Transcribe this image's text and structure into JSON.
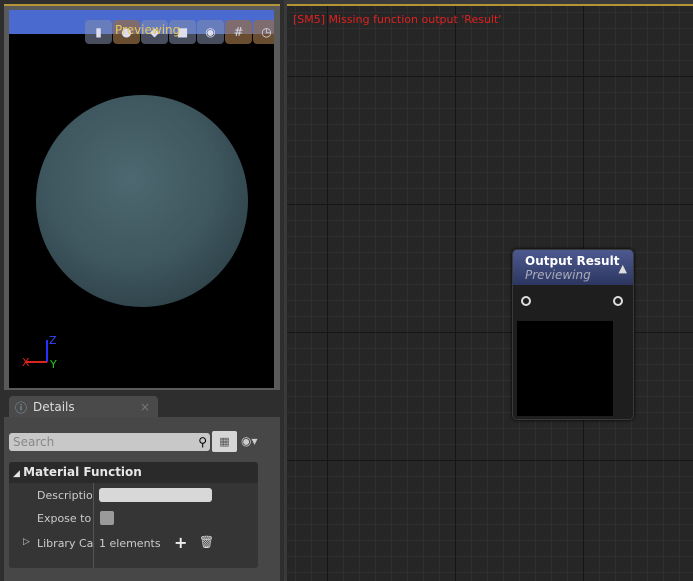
{
  "viewport": {
    "status": "Previewing",
    "toolbar_icons": [
      "cylinder-icon",
      "sphere-icon",
      "plane-icon",
      "cube-icon",
      "mesh-icon",
      "grid-icon",
      "realtime-icon"
    ],
    "axes": {
      "x": "X",
      "y": "Y",
      "z": "Z"
    }
  },
  "details": {
    "tab_label": "Details",
    "close": "×",
    "search_placeholder": "Search",
    "category": "Material Function",
    "rows": [
      {
        "label": "Description",
        "value": ""
      },
      {
        "label": "Expose to Library",
        "checked": false
      },
      {
        "label": "Library Categories",
        "value": "1 elements"
      }
    ]
  },
  "graph": {
    "error": "[SM5] Missing function output 'Result'",
    "node": {
      "title": "Output Result",
      "subtitle": "Previewing"
    }
  }
}
